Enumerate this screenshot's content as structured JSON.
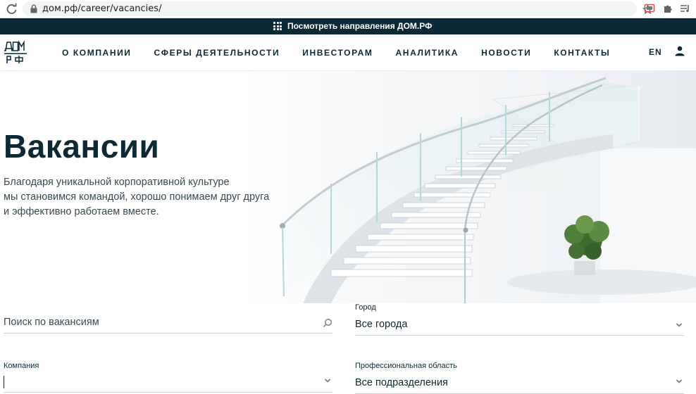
{
  "browser": {
    "url": "дом.рф/career/vacancies/"
  },
  "promo": {
    "text": "Посмотреть направления ДОМ.РФ"
  },
  "header": {
    "nav": [
      {
        "label": "О КОМПАНИИ"
      },
      {
        "label": "СФЕРЫ ДЕЯТЕЛЬНОСТИ"
      },
      {
        "label": "ИНВЕСТОРАМ"
      },
      {
        "label": "АНАЛИТИКА"
      },
      {
        "label": "НОВОСТИ"
      },
      {
        "label": "КОНТАКТЫ"
      }
    ],
    "lang": "EN"
  },
  "hero": {
    "title": "Вакансии",
    "subtitle_lines": [
      "Благодаря уникальной корпоративной культуре",
      "мы становимся командой, хорошо понимаем друг друга",
      "и эффективно работаем вместе."
    ]
  },
  "filters": {
    "search": {
      "placeholder": "Поиск по вакансиям",
      "value": ""
    },
    "city": {
      "label": "Город",
      "value": "Все города"
    },
    "company": {
      "label": "Компания",
      "value": ""
    },
    "department": {
      "label": "Профессиональная область",
      "value": "Все подразделения"
    }
  },
  "colors": {
    "brand_dark": "#0c2a35",
    "text_muted": "#3a4a52",
    "divider": "#cfd4d7"
  }
}
